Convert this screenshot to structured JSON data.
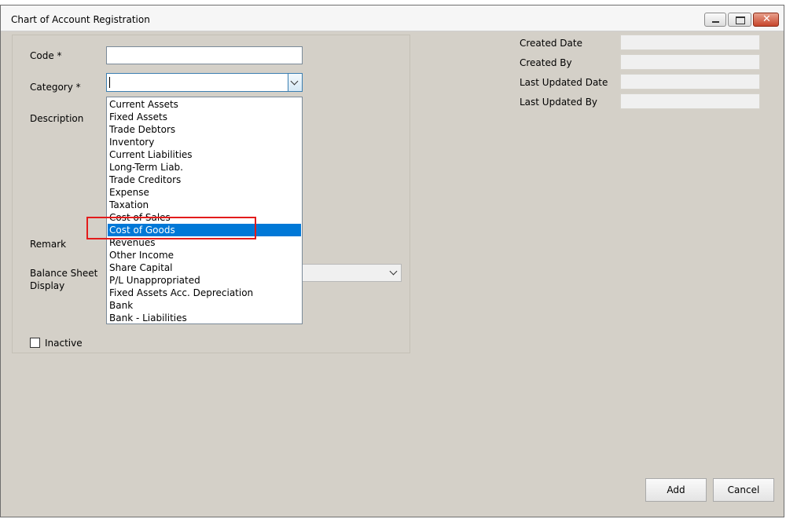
{
  "window": {
    "title": "Chart of Account Registration"
  },
  "form": {
    "code_label": "Code *",
    "code_value": "",
    "category_label": "Category *",
    "category_value": "",
    "description_label": "Description",
    "remark_label": "Remark",
    "balance_sheet_label_line1": "Balance Sheet",
    "balance_sheet_label_line2": "Display",
    "inactive_label": "Inactive",
    "inactive_checked": false
  },
  "category_dropdown": {
    "selected": "Cost of Goods",
    "items": [
      {
        "label": "Current Assets"
      },
      {
        "label": "Fixed Assets"
      },
      {
        "label": "Trade Debtors"
      },
      {
        "label": "Inventory"
      },
      {
        "label": "Current Liabilities"
      },
      {
        "label": "Long-Term Liab."
      },
      {
        "label": "Trade Creditors"
      },
      {
        "label": "Expense"
      },
      {
        "label": "Taxation"
      },
      {
        "label": "Cost of Sales"
      },
      {
        "label": "Cost of Goods"
      },
      {
        "label": "Revenues"
      },
      {
        "label": "Other Income"
      },
      {
        "label": "Share Capital"
      },
      {
        "label": "P/L Unappropriated"
      },
      {
        "label": "Fixed Assets Acc. Depreciation"
      },
      {
        "label": "Bank"
      },
      {
        "label": "Bank - Liabilities"
      }
    ]
  },
  "info": {
    "created_date_label": "Created Date",
    "created_by_label": "Created By",
    "last_updated_date_label": "Last Updated Date",
    "last_updated_by_label": "Last Updated By",
    "created_date_value": "",
    "created_by_value": "",
    "last_updated_date_value": "",
    "last_updated_by_value": ""
  },
  "buttons": {
    "add": "Add",
    "cancel": "Cancel"
  },
  "colors": {
    "selection": "#0078d7",
    "annotation": "#e31b1b",
    "background": "#d4d0c8"
  }
}
